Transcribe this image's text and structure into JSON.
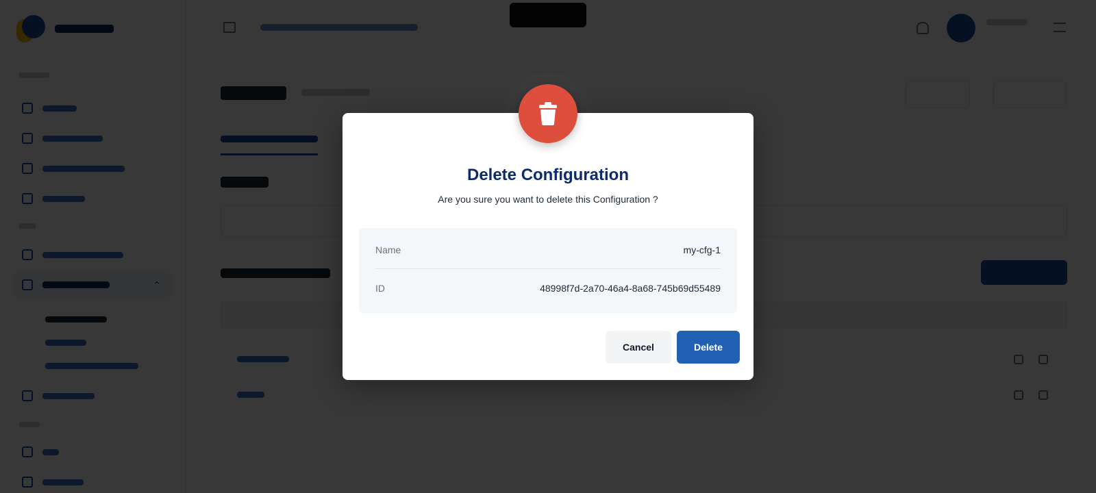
{
  "dialog": {
    "title": "Delete Configuration",
    "message": "Are you sure you want to delete this Configuration ?",
    "details": [
      {
        "label": "Name",
        "value": "my-cfg-1"
      },
      {
        "label": "ID",
        "value": "48998f7d-2a70-46a4-8a68-745b69d55489"
      }
    ],
    "cancel_label": "Cancel",
    "delete_label": "Delete",
    "icon": "trash-icon"
  },
  "colors": {
    "danger": "#dd4f3c",
    "primary": "#2161b3",
    "title": "#0b2b6b"
  }
}
